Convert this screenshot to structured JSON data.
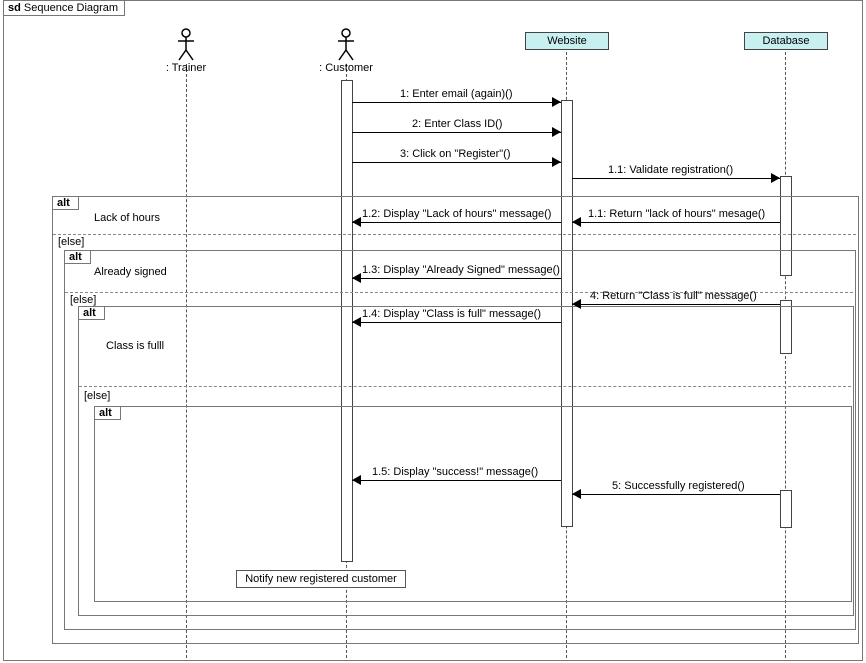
{
  "frame": {
    "kind": "sd",
    "title": "Sequence Diagram"
  },
  "actors": {
    "trainer": ": Trainer",
    "customer": ": Customer"
  },
  "participants": {
    "website": "Website",
    "database": "Database"
  },
  "messages": {
    "m1": "1: Enter email (again)()",
    "m2": "2: Enter Class ID()",
    "m3": "3: Click on \"Register\"()",
    "m11": "1.1: Validate registration()",
    "r111": "1.1: Return \"lack of hours\" mesage()",
    "d12": "1.2: Display \"Lack of hours\"  message()",
    "d13": "1.3: Display \"Already Signed\" message()",
    "r4": "4: Return \"Class is full\" message()",
    "d14": "1.4: Display \"Class is full\" message()",
    "d15": "1.5: Display \"success!\" message()",
    "r5": "5: Successfully registered()"
  },
  "fragments": {
    "alt": "alt",
    "else": "[else]",
    "g_lack": "Lack of hours",
    "g_signed": "Already signed",
    "g_full": "Class is fulll"
  },
  "note": {
    "notify": "Notify new registered customer"
  }
}
